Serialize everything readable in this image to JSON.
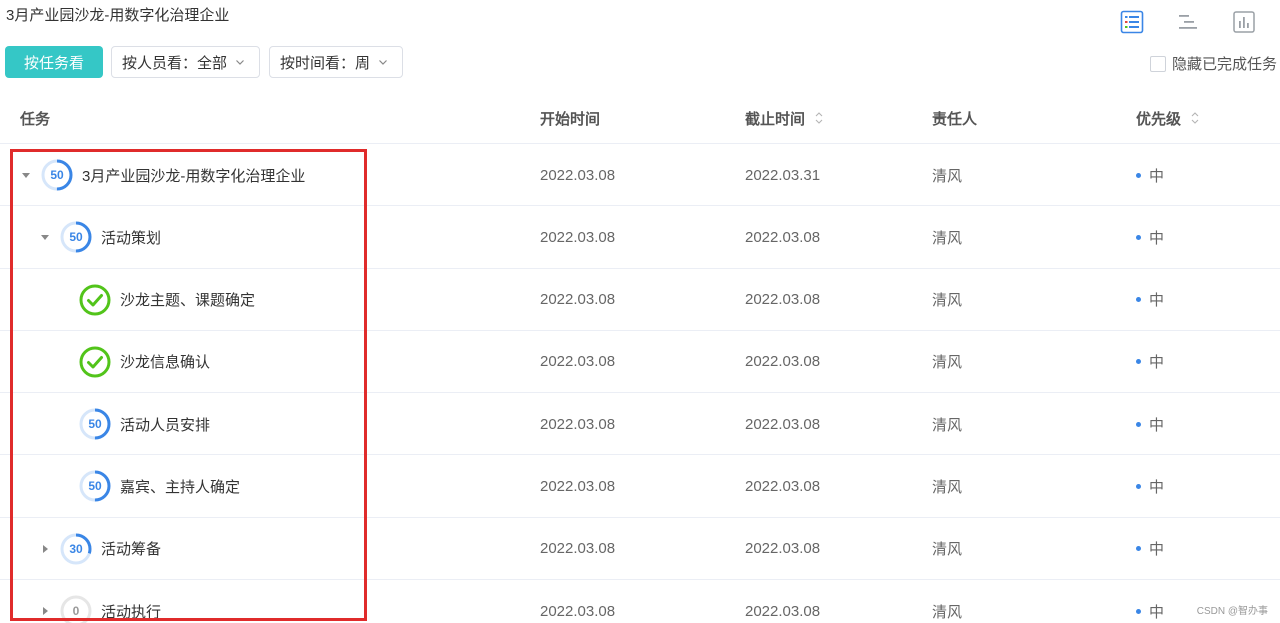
{
  "page": {
    "title": "3月产业园沙龙-用数字化治理企业"
  },
  "view_switch": {
    "items": [
      {
        "icon": "list-view-icon",
        "active": true
      },
      {
        "icon": "gantt-view-icon",
        "active": false
      },
      {
        "icon": "chart-view-icon",
        "active": false
      }
    ],
    "active_color": "#3a86e6"
  },
  "toolbar": {
    "by_task_label": "按任务看",
    "by_person_label": "按人员看：全部",
    "by_time_label": "按时间看：周",
    "hide_completed_label": "隐藏已完成任务",
    "accent": "#35c7c6"
  },
  "table": {
    "headers": {
      "task": "任务",
      "start": "开始时间",
      "end": "截止时间",
      "owner": "责任人",
      "priority": "优先级"
    },
    "rows": [
      {
        "level": 0,
        "caret": "down",
        "status": "progress",
        "progress": "50",
        "progress_value": 50,
        "name": "3月产业园沙龙-用数字化治理企业",
        "start": "2022.03.08",
        "end": "2022.03.31",
        "owner": "清风",
        "priority": "中"
      },
      {
        "level": 1,
        "caret": "down",
        "status": "progress",
        "progress": "50",
        "progress_value": 50,
        "name": "活动策划",
        "start": "2022.03.08",
        "end": "2022.03.08",
        "owner": "清风",
        "priority": "中"
      },
      {
        "level": 2,
        "caret": "none",
        "status": "done",
        "progress": "",
        "progress_value": 100,
        "name": "沙龙主题、课题确定",
        "start": "2022.03.08",
        "end": "2022.03.08",
        "owner": "清风",
        "priority": "中"
      },
      {
        "level": 2,
        "caret": "none",
        "status": "done",
        "progress": "",
        "progress_value": 100,
        "name": "沙龙信息确认",
        "start": "2022.03.08",
        "end": "2022.03.08",
        "owner": "清风",
        "priority": "中"
      },
      {
        "level": 2,
        "caret": "none",
        "status": "progress",
        "progress": "50",
        "progress_value": 50,
        "name": "活动人员安排",
        "start": "2022.03.08",
        "end": "2022.03.08",
        "owner": "清风",
        "priority": "中"
      },
      {
        "level": 2,
        "caret": "none",
        "status": "progress",
        "progress": "50",
        "progress_value": 50,
        "name": "嘉宾、主持人确定",
        "start": "2022.03.08",
        "end": "2022.03.08",
        "owner": "清风",
        "priority": "中"
      },
      {
        "level": 1,
        "caret": "right",
        "status": "progress",
        "progress": "30",
        "progress_value": 30,
        "name": "活动筹备",
        "start": "2022.03.08",
        "end": "2022.03.08",
        "owner": "清风",
        "priority": "中"
      },
      {
        "level": 1,
        "caret": "right",
        "status": "progress",
        "progress": "0",
        "progress_value": 0,
        "name": "活动执行",
        "start": "2022.03.08",
        "end": "2022.03.08",
        "owner": "清风",
        "priority": "中"
      }
    ],
    "colors": {
      "progress": "#3a86e6",
      "track": "#d6e6fa",
      "done": "#52c41a",
      "priority_dot": "#3a86e6"
    }
  },
  "annotation": {
    "highlight_color": "#e02b2b"
  },
  "watermark": "CSDN @智办事"
}
